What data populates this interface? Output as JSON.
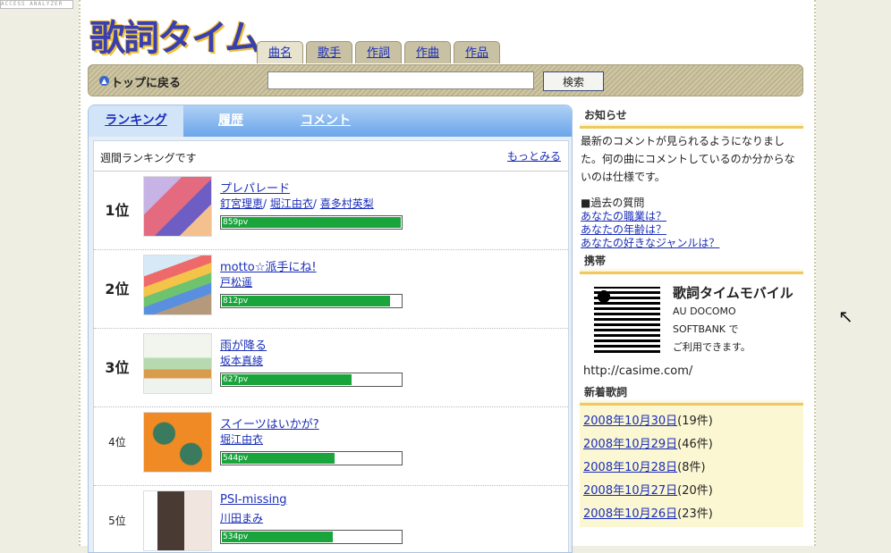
{
  "corner_badge": "ACCESS ANALYZER",
  "logo_text": "歌詞タイム",
  "tabs": [
    {
      "label": "曲名"
    },
    {
      "label": "歌手"
    },
    {
      "label": "作詞"
    },
    {
      "label": "作曲"
    },
    {
      "label": "作品"
    }
  ],
  "search": {
    "back_to_top": "トップに戻る",
    "value": "",
    "placeholder": "",
    "button": "検索"
  },
  "main_tabs": [
    "ランキング",
    "履歴",
    "コメント"
  ],
  "ranking": {
    "header": "週間ランキングです",
    "more": "もっとみる",
    "rows": [
      {
        "rank": "1位",
        "song": "プレパレード",
        "artists": [
          "釘宮理恵",
          "堀江由衣",
          "喜多村英梨"
        ],
        "pv": "859pv",
        "pv_value": 859
      },
      {
        "rank": "2位",
        "song": "motto☆派手にね!",
        "artists": [
          "戸松遥"
        ],
        "pv": "812pv",
        "pv_value": 812
      },
      {
        "rank": "3位",
        "song": "雨が降る",
        "artists": [
          "坂本真綾"
        ],
        "pv": "627pv",
        "pv_value": 627
      },
      {
        "rank": "4位",
        "song": "スイーツはいかが?",
        "artists": [
          "堀江由衣"
        ],
        "pv": "544pv",
        "pv_value": 544
      },
      {
        "rank": "5位",
        "song": "PSI-missing",
        "artists": [
          "川田まみ"
        ],
        "pv": "534pv",
        "pv_value": 534
      }
    ]
  },
  "sidebar": {
    "notice_title": "お知らせ",
    "notice_text": "最新のコメントが見られるようになりました。何の曲にコメントしているのか分からないのは仕様です。",
    "past_questions_label": "■過去の質問",
    "questions": [
      "あなたの職業は？",
      "あなたの年齢は？",
      "あなたの好きなジャンルは？"
    ],
    "mobile_title": "携帯",
    "mobile_name": "歌詞タイムモバイル",
    "carriers": "AU DOCOMO",
    "carriers2": "SOFTBANK で",
    "usable": "ご利用できます。",
    "url": "http://casime.com/",
    "new_title": "新着歌詞",
    "new_items": [
      {
        "date": "2008年10月30日",
        "count": "(19件)"
      },
      {
        "date": "2008年10月29日",
        "count": "(46件)"
      },
      {
        "date": "2008年10月28日",
        "count": "(8件)"
      },
      {
        "date": "2008年10月27日",
        "count": "(20件)"
      },
      {
        "date": "2008年10月26日",
        "count": "(23件)"
      }
    ]
  },
  "colors": {
    "accent": "#1a2db8",
    "pv_bar": "#1aa43c",
    "tab_blue": "#6aa5ea"
  }
}
